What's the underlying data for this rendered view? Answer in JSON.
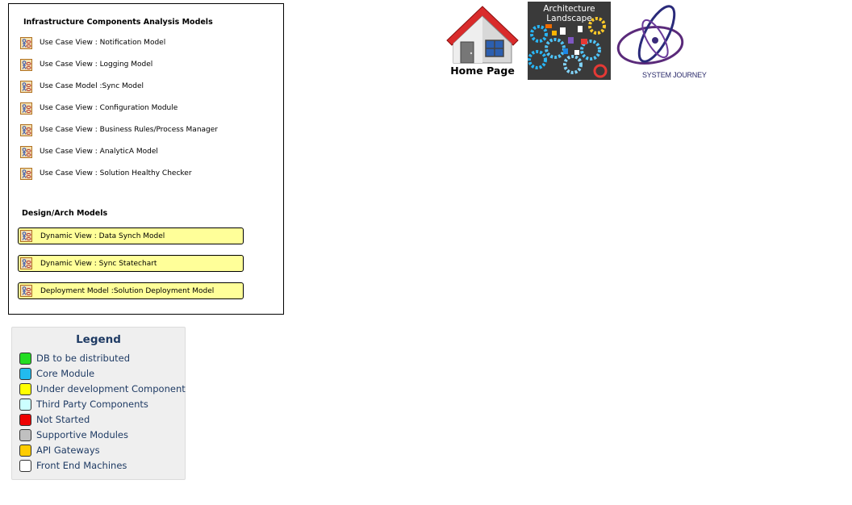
{
  "infra_section": {
    "title": "Infrastructure Components Analysis Models",
    "items": [
      {
        "label": "Use Case View : Notification Model"
      },
      {
        "label": "Use Case View : Logging Model"
      },
      {
        "label": "Use Case Model :Sync Model"
      },
      {
        "label": "Use Case View : Configuration Module"
      },
      {
        "label": "Use Case View : Business Rules/Process Manager"
      },
      {
        "label": "Use Case View : AnalyticA Model"
      },
      {
        "label": "Use Case View : Solution Healthy Checker"
      }
    ]
  },
  "design_section": {
    "title": "Design/Arch Models",
    "items": [
      {
        "label": "Dynamic View : Data Synch Model"
      },
      {
        "label": "Dynamic View : Sync Statechart"
      },
      {
        "label": "Deployment Model :Solution Deployment Model"
      }
    ]
  },
  "legend": {
    "title": "Legend",
    "items": [
      {
        "label": "DB to be distributed",
        "color": "#22dd22"
      },
      {
        "label": "Core Module",
        "color": "#22bbee"
      },
      {
        "label": "Under development Component",
        "color": "#ffff00"
      },
      {
        "label": "Third Party Components",
        "color": "#ccffff"
      },
      {
        "label": "Not Started",
        "color": "#ee0000"
      },
      {
        "label": "Supportive Modules",
        "color": "#c0c0c0"
      },
      {
        "label": "API Gateways",
        "color": "#ffcc00"
      },
      {
        "label": "Front End Machines",
        "color": "#ffffff"
      }
    ]
  },
  "links": {
    "home_label": "Home Page",
    "architecture_label": "Architecture Landscape",
    "journey_label": "SYSTEM JOURNEY"
  },
  "icons": {
    "model_icon": "use-case-diagram-icon",
    "home_icon": "house-icon",
    "architecture_icon": "gears-icon",
    "journey_icon": "orbit-logo-icon"
  }
}
